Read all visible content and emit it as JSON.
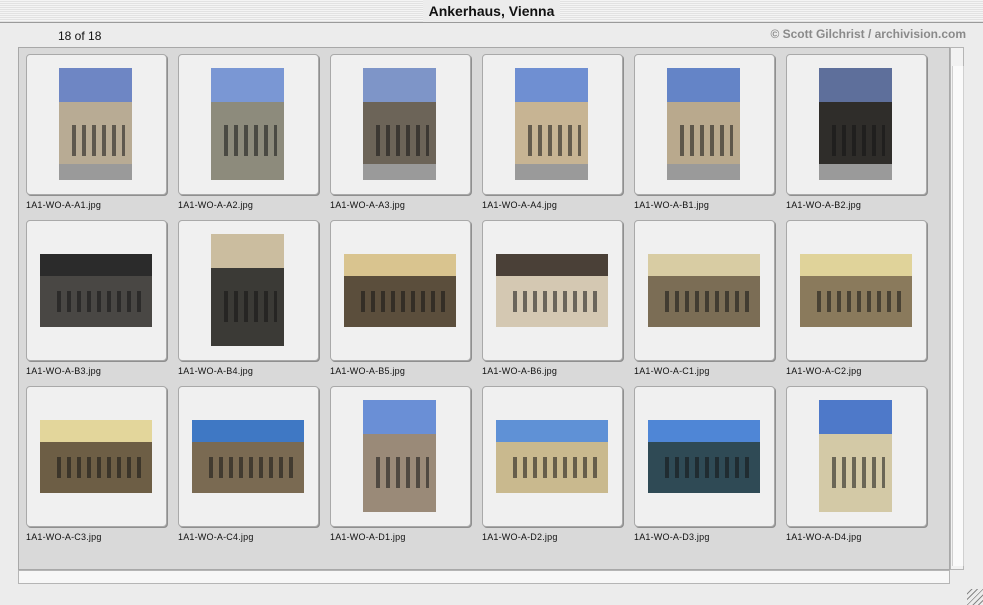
{
  "window": {
    "title": "Ankerhaus, Vienna"
  },
  "header": {
    "count_label": "18 of 18",
    "credit": "© Scott Gilchrist / archivision.com"
  },
  "thumbnails": [
    {
      "filename": "1A1-WO-A-A1.jpg",
      "orientation": "portrait",
      "sky": "#6e86c4",
      "building": "#b8ab94",
      "street": true
    },
    {
      "filename": "1A1-WO-A-A2.jpg",
      "orientation": "portrait",
      "sky": "#7a97d4",
      "building": "#8d8b7c",
      "street": false
    },
    {
      "filename": "1A1-WO-A-A3.jpg",
      "orientation": "portrait",
      "sky": "#7e95c8",
      "building": "#6c6458",
      "street": true
    },
    {
      "filename": "1A1-WO-A-A4.jpg",
      "orientation": "portrait",
      "sky": "#6f8fd2",
      "building": "#c7b493",
      "street": true
    },
    {
      "filename": "1A1-WO-A-B1.jpg",
      "orientation": "portrait",
      "sky": "#6484c7",
      "building": "#b9a98d",
      "street": true
    },
    {
      "filename": "1A1-WO-A-B2.jpg",
      "orientation": "portrait",
      "sky": "#5e6f9b",
      "building": "#2f2d2a",
      "street": true
    },
    {
      "filename": "1A1-WO-A-B3.jpg",
      "orientation": "landscape",
      "sky": "#2b2b2b",
      "building": "#494744",
      "street": false
    },
    {
      "filename": "1A1-WO-A-B4.jpg",
      "orientation": "portrait",
      "sky": "#cbbd9f",
      "building": "#3b3a36",
      "street": false
    },
    {
      "filename": "1A1-WO-A-B5.jpg",
      "orientation": "landscape",
      "sky": "#d9c48f",
      "building": "#5b4e3c",
      "street": false
    },
    {
      "filename": "1A1-WO-A-B6.jpg",
      "orientation": "landscape",
      "sky": "#4a4037",
      "building": "#d4c8b2",
      "street": false
    },
    {
      "filename": "1A1-WO-A-C1.jpg",
      "orientation": "landscape",
      "sky": "#d8cca3",
      "building": "#7b6d55",
      "street": false
    },
    {
      "filename": "1A1-WO-A-C2.jpg",
      "orientation": "landscape",
      "sky": "#e0d39a",
      "building": "#8a7a5c",
      "street": false
    },
    {
      "filename": "1A1-WO-A-C3.jpg",
      "orientation": "landscape",
      "sky": "#e3d69b",
      "building": "#6d5e45",
      "street": false
    },
    {
      "filename": "1A1-WO-A-C4.jpg",
      "orientation": "landscape",
      "sky": "#3f78c4",
      "building": "#7a6a52",
      "street": false
    },
    {
      "filename": "1A1-WO-A-D1.jpg",
      "orientation": "portrait",
      "sky": "#6a8fd6",
      "building": "#9a8a78",
      "street": false
    },
    {
      "filename": "1A1-WO-A-D2.jpg",
      "orientation": "landscape",
      "sky": "#5f91d6",
      "building": "#c9b98e",
      "street": false
    },
    {
      "filename": "1A1-WO-A-D3.jpg",
      "orientation": "landscape",
      "sky": "#4f86d6",
      "building": "#2f4a55",
      "street": false
    },
    {
      "filename": "1A1-WO-A-D4.jpg",
      "orientation": "portrait",
      "sky": "#4e79c9",
      "building": "#d3c9a6",
      "street": false
    }
  ]
}
